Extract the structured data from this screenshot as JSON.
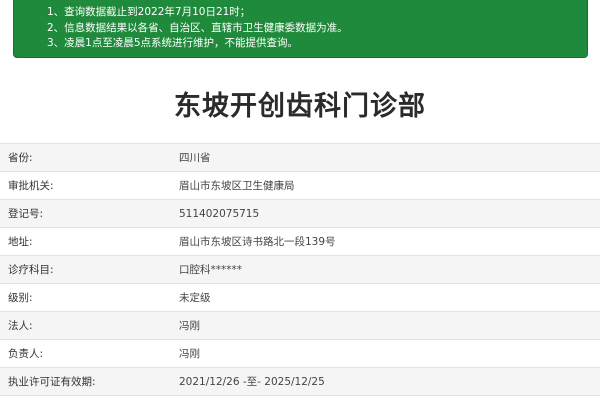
{
  "notice": {
    "lines": [
      "1、查询数据截止到2022年7月10日21时；",
      "2、信息数据结果以各省、自治区、直辖市卫生健康委数据为准。",
      "3、凌晨1点至凌晨5点系统进行维护，不能提供查询。"
    ]
  },
  "title": "东坡开创齿科门诊部",
  "rows": [
    {
      "label": "省份:",
      "value": "四川省"
    },
    {
      "label": "审批机关:",
      "value": "眉山市东坡区卫生健康局"
    },
    {
      "label": "登记号:",
      "value": "511402075715"
    },
    {
      "label": "地址:",
      "value": "眉山市东坡区诗书路北一段139号"
    },
    {
      "label": "诊疗科目:",
      "value": "口腔科******"
    },
    {
      "label": "级别:",
      "value": "未定级"
    },
    {
      "label": "法人:",
      "value": "冯刚"
    },
    {
      "label": "负责人:",
      "value": "冯刚"
    },
    {
      "label": "执业许可证有效期:",
      "value": "2021/12/26 -至- 2025/12/25"
    }
  ],
  "colors": {
    "notice_background": "#1f8a3b",
    "row_stripe": "#f5f5f5"
  }
}
